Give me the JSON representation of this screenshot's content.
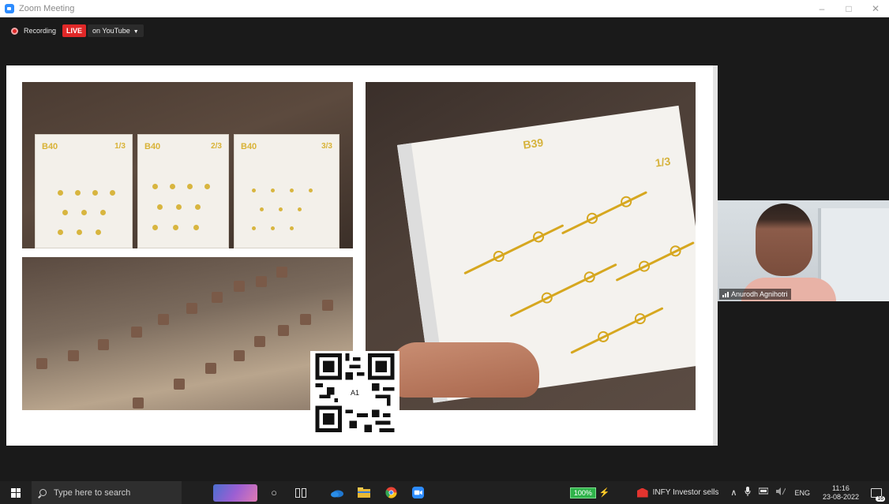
{
  "window": {
    "title": "Zoom Meeting",
    "controls": {
      "minimize": "–",
      "maximize": "□",
      "close": "✕"
    }
  },
  "recording": {
    "label": "Recording",
    "live_badge": "LIVE",
    "stream_target": "on YouTube",
    "dropdown_caret": "▼"
  },
  "share": {
    "cards": [
      {
        "label": "B40",
        "fraction": "1/3"
      },
      {
        "label": "B40",
        "fraction": "2/3"
      },
      {
        "label": "B40",
        "fraction": "3/3"
      }
    ],
    "sheet": {
      "label": "B39",
      "fraction": "1/3"
    },
    "qr_text": "A1"
  },
  "participant": {
    "name": "Anurodh Agnihotri"
  },
  "taskbar": {
    "search_placeholder": "Type here to search",
    "task_view_glyph": "○",
    "battery": "100%",
    "stock_ticker": "INFY",
    "stock_text": "Investor sells",
    "chevron": "∧",
    "language": "ENG",
    "time": "11:16",
    "date": "23-08-2022",
    "notification_count": "16"
  },
  "colors": {
    "live_red": "#e02828",
    "zoom_blue": "#2d8cff",
    "battery_green": "#2fb34a",
    "print_yellow": "#d9b338"
  }
}
